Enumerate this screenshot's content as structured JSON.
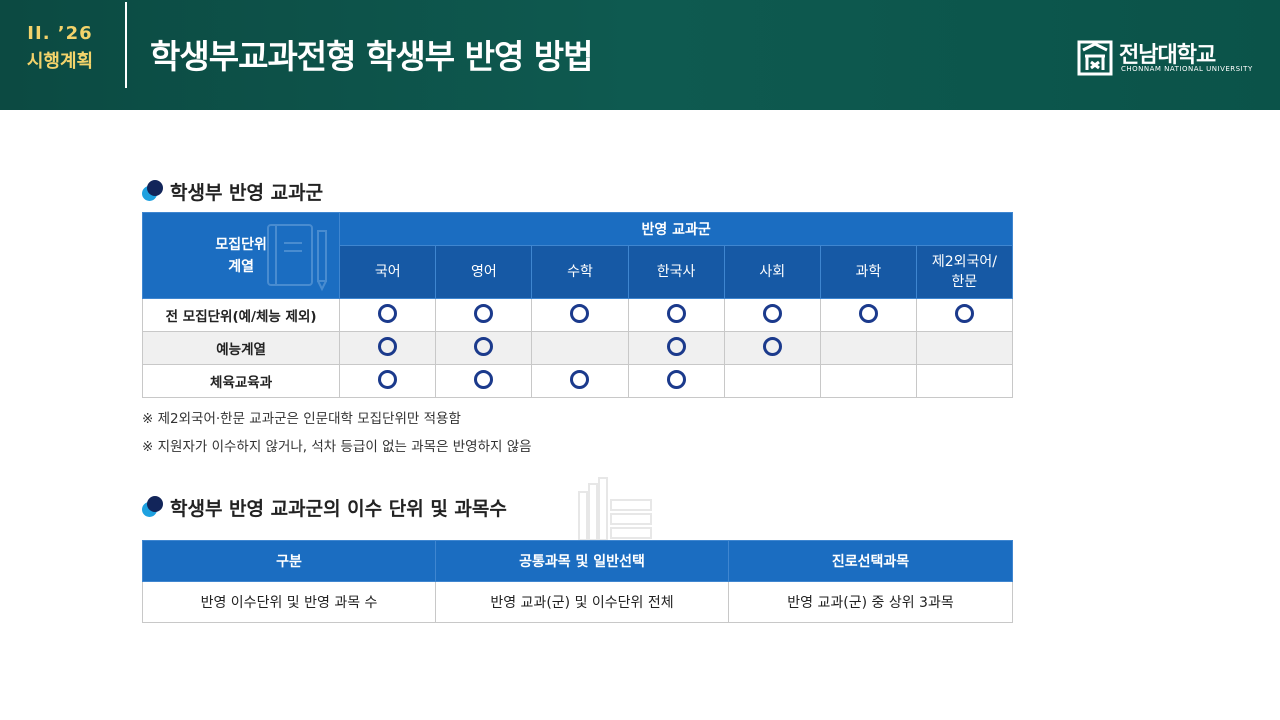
{
  "header": {
    "section_number": "II. ’26",
    "section_name": "시행계획",
    "title": "학생부교과전형 학생부 반영 방법",
    "logo_name": "전남대학교",
    "logo_sub": "CHONNAM NATIONAL UNIVERSITY"
  },
  "section1": {
    "heading": "학생부 반영 교과군",
    "table": {
      "corner_label": "모집단위\n계열",
      "group_header": "반영 교과군",
      "columns": [
        "국어",
        "영어",
        "수학",
        "한국사",
        "사회",
        "과학",
        "제2외국어/\n한문"
      ],
      "rows": [
        {
          "label": "전 모집단위(예/체능 제외)",
          "marks": [
            true,
            true,
            true,
            true,
            true,
            true,
            true
          ]
        },
        {
          "label": "예능계열",
          "marks": [
            true,
            true,
            false,
            true,
            true,
            false,
            false
          ]
        },
        {
          "label": "체육교육과",
          "marks": [
            true,
            true,
            true,
            true,
            false,
            false,
            false
          ]
        }
      ]
    },
    "notes": [
      "※ 제2외국어·한문 교과군은 인문대학 모집단위만 적용함",
      "※ 지원자가 이수하지 않거나, 석차 등급이 없는 과목은 반영하지 않음"
    ]
  },
  "section2": {
    "heading": "학생부 반영 교과군의 이수 단위 및 과목수",
    "table": {
      "headers": [
        "구분",
        "공통과목 및 일반선택",
        "진로선택과목"
      ],
      "row": [
        "반영 이수단위 및 반영 과목 수",
        "반영 교과(군) 및 이수단위 전체",
        "반영 교과(군) 중 상위 3과목"
      ]
    }
  },
  "colors": {
    "header_bg": "#0e5a50",
    "section_accent": "#f3d36b",
    "table_header": "#1b6dc1",
    "mark": "#1b3a8c"
  }
}
